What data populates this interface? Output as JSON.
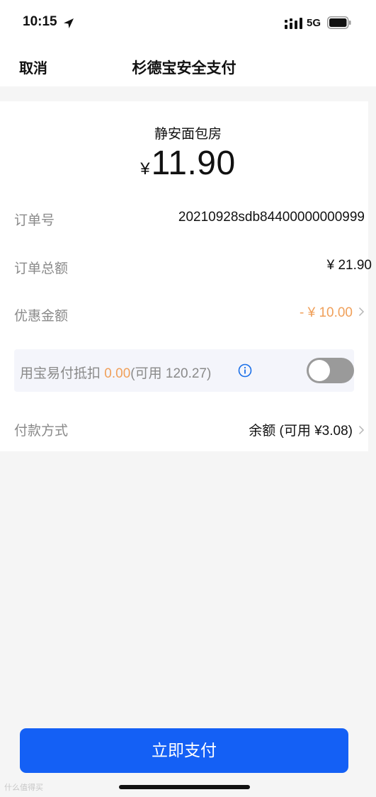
{
  "status_bar": {
    "time": "10:15",
    "network": "5G",
    "icons": [
      "location-arrow-icon",
      "signal-icon",
      "battery-icon"
    ]
  },
  "navbar": {
    "cancel_label": "取消",
    "title": "杉德宝安全支付"
  },
  "payment": {
    "merchant": "静安面包房",
    "currency": "¥",
    "amount": "11.90"
  },
  "details": {
    "order_no_label": "订单号",
    "order_no_value": "20210928sdb84400000000999",
    "total_label": "订单总额",
    "total_value": "¥ 21.90",
    "discount_label": "优惠金额",
    "discount_value": "- ¥ 10.00",
    "payment_method_label": "付款方式",
    "payment_method_value": "余额 (可用 ¥3.08)"
  },
  "deduction": {
    "prefix": "用宝易付抵扣 ",
    "amount": "0.00",
    "available": "(可用 120.27)",
    "toggle_on": false
  },
  "pay_button_label": "立即支付",
  "watermark": "什么值得买",
  "colors": {
    "primary": "#1460f5",
    "discount_orange": "#f0a05a",
    "info_blue": "#1a6fe8",
    "background": "#f5f5f5"
  }
}
